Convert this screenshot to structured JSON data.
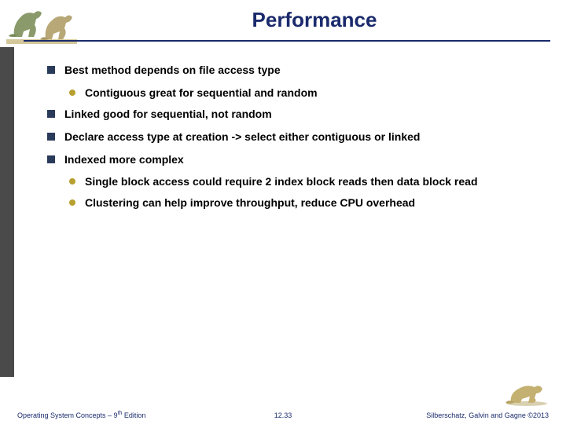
{
  "title": "Performance",
  "bullets": {
    "b1": "Best method depends on file access type",
    "b1_1": "Contiguous great for sequential and random",
    "b2": "Linked good for sequential, not random",
    "b3": "Declare access type at creation -> select either contiguous or linked",
    "b4": "Indexed more complex",
    "b4_1": "Single block access could require 2 index block reads then data block read",
    "b4_2": "Clustering can help improve throughput, reduce CPU overhead"
  },
  "footer": {
    "left_prefix": "Operating System Concepts – 9",
    "left_suffix": " Edition",
    "left_sup": "th",
    "center": "12.33",
    "right": "Silberschatz, Galvin and Gagne ©2013"
  }
}
